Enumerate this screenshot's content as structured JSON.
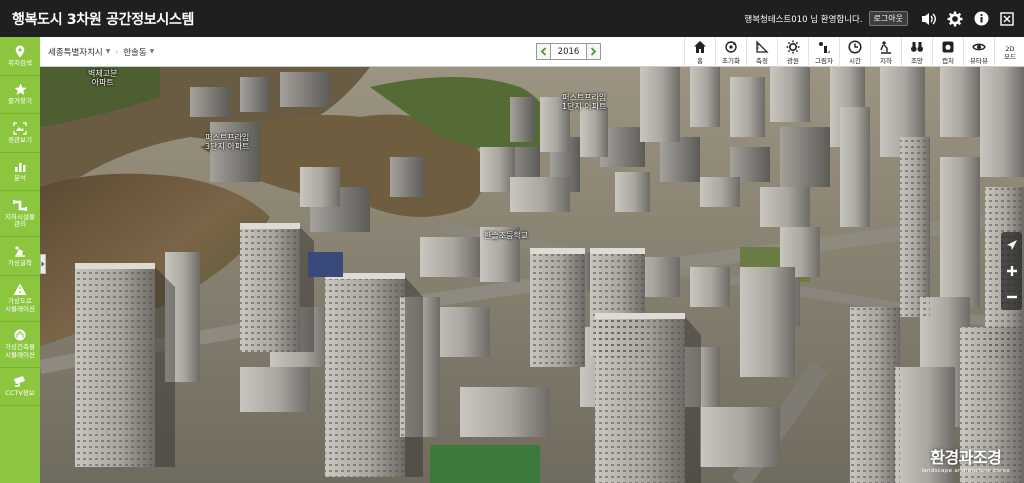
{
  "header": {
    "title": "행복도시 3차원 공간정보시스템",
    "welcome": "행복청테스트010 님 환영합니다.",
    "logout": "로그아웃"
  },
  "sidebar": {
    "items": [
      {
        "label": "위치검색",
        "icon": "location-pin-icon"
      },
      {
        "label": "즐겨찾기",
        "icon": "star-icon"
      },
      {
        "label": "경관보기",
        "icon": "landscape-view-icon"
      },
      {
        "label": "분석",
        "icon": "analysis-chart-icon"
      },
      {
        "label": "지하시설물\n관리",
        "icon": "pipe-icon"
      },
      {
        "label": "가상굴착",
        "icon": "excavation-icon"
      },
      {
        "label": "가상도로\n시뮬레이션",
        "icon": "road-icon"
      },
      {
        "label": "가상건축물\n시뮬레이션",
        "icon": "building-icon"
      },
      {
        "label": "CCTV정보",
        "icon": "cctv-icon"
      }
    ]
  },
  "toolbar": {
    "breadcrumb": [
      "세종특별자치시",
      "한솔동"
    ],
    "year": "2016",
    "tools": [
      {
        "label": "홈",
        "icon": "home-icon"
      },
      {
        "label": "초기화",
        "icon": "reset-icon"
      },
      {
        "label": "측정",
        "icon": "measure-icon"
      },
      {
        "label": "광원",
        "icon": "sun-icon"
      },
      {
        "label": "그림자",
        "icon": "shadow-icon"
      },
      {
        "label": "시간",
        "icon": "clock-icon"
      },
      {
        "label": "지하",
        "icon": "underground-icon"
      },
      {
        "label": "조망",
        "icon": "binoculars-icon"
      },
      {
        "label": "캡처",
        "icon": "camera-icon"
      },
      {
        "label": "뷰타뷰",
        "icon": "eye-icon"
      },
      {
        "label": "2D\n모드",
        "icon": "mode-2d-icon"
      }
    ]
  },
  "map": {
    "labels": [
      {
        "text": "벽제고분\n아파트"
      },
      {
        "text": "퍼스트프라임\n3단지 아파트"
      },
      {
        "text": "퍼스트프라임\n1단지 아파트"
      },
      {
        "text": "한솔초등학교"
      }
    ],
    "watermark": {
      "main": "환경과조경",
      "sub": "landscape architecture korea"
    }
  },
  "colors": {
    "sidebar": "#8cc63f",
    "header": "#1f1f1f",
    "year_arrow": "#4a9d2a"
  }
}
